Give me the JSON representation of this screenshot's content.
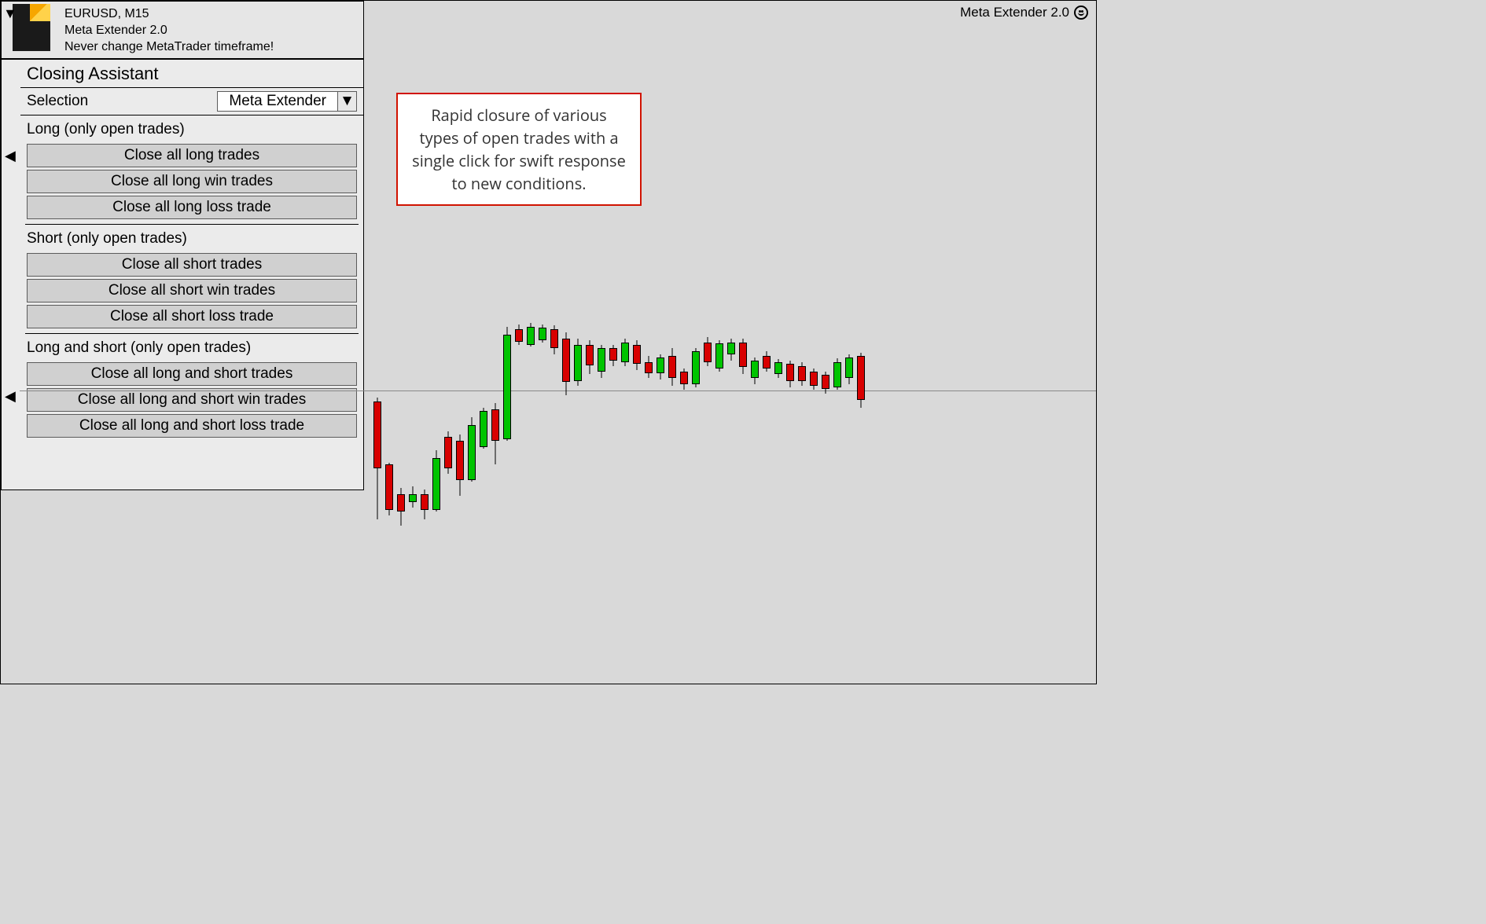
{
  "header": {
    "symbol_tf": "EURUSD, M15",
    "product": "Meta Extender 2.0",
    "warning": "Never change MetaTrader timeframe!"
  },
  "topright": {
    "label": "Meta Extender 2.0"
  },
  "panel": {
    "title": "Closing Assistant",
    "selection_label": "Selection",
    "selection_value": "Meta Extender",
    "sections": [
      {
        "head": "Long (only open trades)",
        "buttons": [
          "Close all long trades",
          "Close all long win trades",
          "Close all long loss trade"
        ]
      },
      {
        "head": "Short (only open trades)",
        "buttons": [
          "Close all short trades",
          "Close all short win trades",
          "Close all short loss trade"
        ]
      },
      {
        "head": "Long and short (only open trades)",
        "buttons": [
          "Close all long and short trades",
          "Close all long and short win trades",
          "Close all long and short loss trade"
        ]
      }
    ]
  },
  "callout": "Rapid closure of various types of open trades with a single click for swift response to new conditions.",
  "chart_data": {
    "type": "candlestick",
    "note": "Values are relative pixel offsets read from the screenshot; no axis scale is visible so numeric prices are not recoverable. 'open'/'close' drive body top/bottom; 'high'/'low' drive wick extent. Higher value = higher on screen. Color g=bullish, r=bearish.",
    "width": 10,
    "gap": 5,
    "candles": [
      {
        "c": "r",
        "high": 185,
        "low": 30,
        "open": 180,
        "close": 95
      },
      {
        "c": "r",
        "high": 102,
        "low": 35,
        "open": 100,
        "close": 42
      },
      {
        "c": "r",
        "high": 70,
        "low": 22,
        "open": 62,
        "close": 40
      },
      {
        "c": "g",
        "high": 72,
        "low": 45,
        "open": 52,
        "close": 62
      },
      {
        "c": "r",
        "high": 68,
        "low": 30,
        "open": 62,
        "close": 42
      },
      {
        "c": "g",
        "high": 118,
        "low": 40,
        "open": 42,
        "close": 108
      },
      {
        "c": "r",
        "high": 142,
        "low": 88,
        "open": 135,
        "close": 95
      },
      {
        "c": "r",
        "high": 138,
        "low": 60,
        "open": 130,
        "close": 80
      },
      {
        "c": "g",
        "high": 160,
        "low": 78,
        "open": 80,
        "close": 150
      },
      {
        "c": "g",
        "high": 172,
        "low": 120,
        "open": 122,
        "close": 168
      },
      {
        "c": "r",
        "high": 178,
        "low": 100,
        "open": 170,
        "close": 130
      },
      {
        "c": "g",
        "high": 275,
        "low": 130,
        "open": 132,
        "close": 265
      },
      {
        "c": "r",
        "high": 278,
        "low": 252,
        "open": 272,
        "close": 256
      },
      {
        "c": "g",
        "high": 280,
        "low": 250,
        "open": 252,
        "close": 275
      },
      {
        "c": "g",
        "high": 278,
        "low": 255,
        "open": 258,
        "close": 274
      },
      {
        "c": "r",
        "high": 277,
        "low": 240,
        "open": 272,
        "close": 248
      },
      {
        "c": "r",
        "high": 268,
        "low": 188,
        "open": 260,
        "close": 205
      },
      {
        "c": "g",
        "high": 260,
        "low": 200,
        "open": 206,
        "close": 252
      },
      {
        "c": "r",
        "high": 258,
        "low": 215,
        "open": 252,
        "close": 226
      },
      {
        "c": "g",
        "high": 252,
        "low": 210,
        "open": 218,
        "close": 248
      },
      {
        "c": "r",
        "high": 252,
        "low": 225,
        "open": 248,
        "close": 232
      },
      {
        "c": "g",
        "high": 260,
        "low": 225,
        "open": 230,
        "close": 255
      },
      {
        "c": "r",
        "high": 258,
        "low": 220,
        "open": 252,
        "close": 228
      },
      {
        "c": "r",
        "high": 238,
        "low": 210,
        "open": 230,
        "close": 216
      },
      {
        "c": "g",
        "high": 240,
        "low": 208,
        "open": 216,
        "close": 236
      },
      {
        "c": "r",
        "high": 248,
        "low": 200,
        "open": 238,
        "close": 210
      },
      {
        "c": "r",
        "high": 222,
        "low": 195,
        "open": 218,
        "close": 202
      },
      {
        "c": "g",
        "high": 248,
        "low": 198,
        "open": 202,
        "close": 244
      },
      {
        "c": "r",
        "high": 262,
        "low": 225,
        "open": 255,
        "close": 230
      },
      {
        "c": "g",
        "high": 258,
        "low": 218,
        "open": 222,
        "close": 254
      },
      {
        "c": "g",
        "high": 260,
        "low": 232,
        "open": 240,
        "close": 255
      },
      {
        "c": "r",
        "high": 260,
        "low": 215,
        "open": 255,
        "close": 224
      },
      {
        "c": "g",
        "high": 236,
        "low": 202,
        "open": 210,
        "close": 232
      },
      {
        "c": "r",
        "high": 244,
        "low": 218,
        "open": 238,
        "close": 222
      },
      {
        "c": "g",
        "high": 234,
        "low": 210,
        "open": 215,
        "close": 230
      },
      {
        "c": "r",
        "high": 232,
        "low": 198,
        "open": 228,
        "close": 206
      },
      {
        "c": "r",
        "high": 230,
        "low": 200,
        "open": 225,
        "close": 206
      },
      {
        "c": "r",
        "high": 222,
        "low": 195,
        "open": 218,
        "close": 200
      },
      {
        "c": "r",
        "high": 218,
        "low": 190,
        "open": 214,
        "close": 196
      },
      {
        "c": "g",
        "high": 235,
        "low": 195,
        "open": 198,
        "close": 230
      },
      {
        "c": "g",
        "high": 240,
        "low": 202,
        "open": 210,
        "close": 236
      },
      {
        "c": "r",
        "high": 242,
        "low": 172,
        "open": 238,
        "close": 182
      }
    ]
  }
}
